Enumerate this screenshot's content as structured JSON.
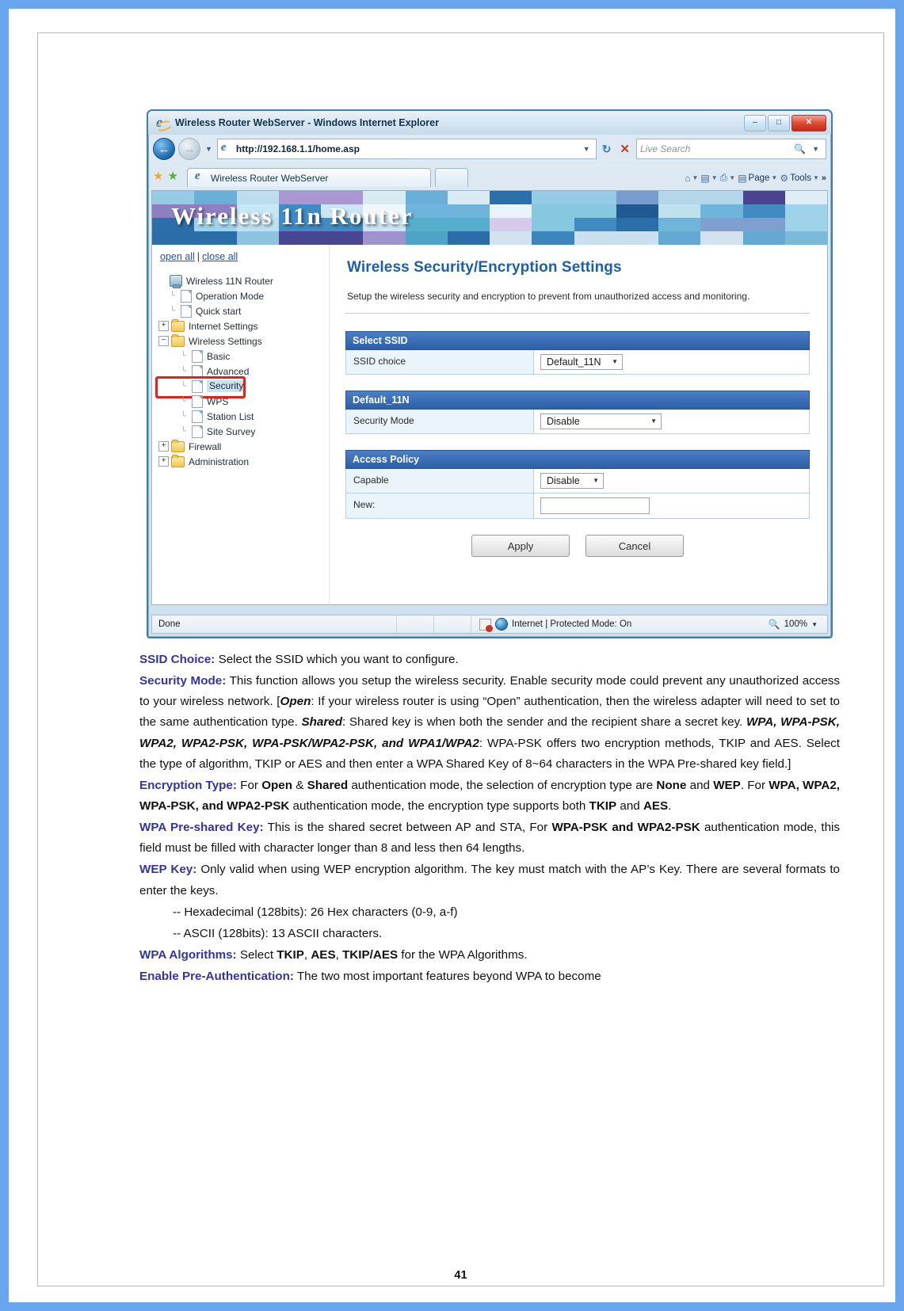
{
  "browser": {
    "window_title": "Wireless Router WebServer - Windows Internet Explorer",
    "minimize_label": "–",
    "maximize_label": "□",
    "close_label": "✕",
    "back_glyph": "←",
    "forward_glyph": "→",
    "nav_caret": "▼",
    "address_url": "http://192.168.1.1/home.asp",
    "address_caret": "▼",
    "refresh_glyph": "↻",
    "stop_glyph": "✕",
    "search_placeholder": "Live Search",
    "search_glyph": "🔍",
    "search_caret": "▼",
    "favorites_star": "★",
    "favorites_add": "★",
    "tab_title": "Wireless Router WebServer",
    "command_bar": [
      {
        "icon": "⌂",
        "label": "",
        "caret": "▼"
      },
      {
        "icon": "▤",
        "label": "",
        "caret": "▼"
      },
      {
        "icon": "⎙",
        "label": "",
        "caret": "▼"
      },
      {
        "icon": "▤",
        "label": "Page",
        "caret": "▼"
      },
      {
        "icon": "⚙",
        "label": "Tools",
        "caret": "▼"
      }
    ],
    "overflow_glyph": "»",
    "status": {
      "left": "Done",
      "zone": "Internet | Protected Mode: On",
      "zoom": "100%",
      "zoom_caret": "▼",
      "zoom_glyph": "🔍"
    }
  },
  "router_ui": {
    "banner_title": "Wireless 11n Router",
    "open_all": "open all",
    "separator": "|",
    "close_all": "close all",
    "tree": [
      {
        "label": "Wireless 11N Router",
        "icon": "computer-icon",
        "depth": 0,
        "expander": "",
        "selected": false,
        "highlight": false
      },
      {
        "label": "Operation Mode",
        "icon": "page-icon",
        "depth": 1,
        "expander": "",
        "selected": false,
        "highlight": false
      },
      {
        "label": "Quick start",
        "icon": "page-icon",
        "depth": 1,
        "expander": "",
        "selected": false,
        "highlight": false
      },
      {
        "label": "Internet Settings",
        "icon": "folder-icon",
        "depth": 0,
        "expander": "+",
        "selected": false,
        "highlight": false
      },
      {
        "label": "Wireless Settings",
        "icon": "folder-icon",
        "depth": 0,
        "expander": "−",
        "selected": false,
        "highlight": false
      },
      {
        "label": "Basic",
        "icon": "page-icon",
        "depth": 2,
        "expander": "",
        "selected": false,
        "highlight": false
      },
      {
        "label": "Advanced",
        "icon": "page-icon",
        "depth": 2,
        "expander": "",
        "selected": false,
        "highlight": false
      },
      {
        "label": "Security",
        "icon": "page-icon",
        "depth": 2,
        "expander": "",
        "selected": true,
        "highlight": true
      },
      {
        "label": "WPS",
        "icon": "page-icon",
        "depth": 2,
        "expander": "",
        "selected": false,
        "highlight": false
      },
      {
        "label": "Station List",
        "icon": "page-icon",
        "depth": 2,
        "expander": "",
        "selected": false,
        "highlight": false
      },
      {
        "label": "Site Survey",
        "icon": "page-icon",
        "depth": 2,
        "expander": "",
        "selected": false,
        "highlight": false
      },
      {
        "label": "Firewall",
        "icon": "folder-icon",
        "depth": 0,
        "expander": "+",
        "selected": false,
        "highlight": false
      },
      {
        "label": "Administration",
        "icon": "folder-icon",
        "depth": 0,
        "expander": "+",
        "selected": false,
        "highlight": false
      }
    ],
    "heading": "Wireless Security/Encryption Settings",
    "description": "Setup the wireless security and encryption to prevent from unauthorized access and monitoring.",
    "sections": [
      {
        "title": "Select SSID",
        "rows": [
          {
            "label": "SSID choice",
            "control": "select",
            "value": "Default_11N",
            "caret": "▼",
            "width_class": "w-ssid"
          }
        ]
      },
      {
        "title": "Default_11N",
        "rows": [
          {
            "label": "Security Mode",
            "control": "select",
            "value": "Disable",
            "caret": "▼",
            "width_class": "w-sec"
          }
        ]
      },
      {
        "title": "Access Policy",
        "rows": [
          {
            "label": "Capable",
            "control": "select",
            "value": "Disable",
            "caret": "▼",
            "width_class": "w-cap"
          },
          {
            "label": "New:",
            "control": "text",
            "value": "",
            "caret": "",
            "width_class": ""
          }
        ]
      }
    ],
    "apply_label": "Apply",
    "cancel_label": "Cancel"
  },
  "document": {
    "paragraphs": [
      {
        "heading": "SSID Choice:",
        "runs": [
          {
            "t": " Select the SSID which you want to configure."
          }
        ]
      },
      {
        "heading": "Security Mode:",
        "runs": [
          {
            "t": " This function allows you setup the wireless security. Enable security mode could prevent any unauthorized access to your wireless network. ["
          },
          {
            "t": "Open",
            "style": "bold-italic"
          },
          {
            "t": ": If your wireless router is using “Open” authentication, then the wireless adapter will need to set to the same authentication type. "
          },
          {
            "t": "Shared",
            "style": "bold-italic"
          },
          {
            "t": ": Shared key is when both the sender and the recipient share a secret key. "
          },
          {
            "t": "WPA, WPA-PSK, WPA2, WPA2-PSK, WPA-PSK/WPA2-PSK, and WPA1/WPA2",
            "style": "bold-italic"
          },
          {
            "t": ": WPA-PSK offers two encryption methods, TKIP and AES. Select the type of algorithm, TKIP or AES and then enter a WPA Shared Key of 8~64 characters in the WPA Pre-shared key field.]"
          }
        ]
      },
      {
        "heading": "Encryption Type:",
        "runs": [
          {
            "t": " For "
          },
          {
            "t": "Open",
            "style": "bold"
          },
          {
            "t": " & "
          },
          {
            "t": "Shared",
            "style": "bold"
          },
          {
            "t": " authentication mode, the selection of encryption type are "
          },
          {
            "t": "None",
            "style": "bold"
          },
          {
            "t": " and "
          },
          {
            "t": "WEP",
            "style": "bold"
          },
          {
            "t": ". For "
          },
          {
            "t": "WPA, WPA2, WPA-PSK, and WPA2-PSK",
            "style": "bold"
          },
          {
            "t": " authentication mode, the encryption type supports both "
          },
          {
            "t": "TKIP",
            "style": "bold"
          },
          {
            "t": " and "
          },
          {
            "t": "AES",
            "style": "bold"
          },
          {
            "t": "."
          }
        ]
      },
      {
        "heading": "WPA Pre-shared Key:",
        "runs": [
          {
            "t": " This is the shared secret between AP and STA, For "
          },
          {
            "t": "WPA-PSK and WPA2-PSK",
            "style": "bold"
          },
          {
            "t": " authentication mode, this field must be filled with character longer than 8 and less then 64 lengths."
          }
        ]
      },
      {
        "heading": "WEP Key:",
        "runs": [
          {
            "t": " Only valid when using WEP encryption algorithm. The key must match with the AP’s Key. There are several formats to enter the keys."
          }
        ]
      }
    ],
    "bullets": [
      "-- Hexadecimal (128bits): 26 Hex characters (0-9, a-f)",
      "-- ASCII (128bits): 13 ASCII characters."
    ],
    "paragraphs_tail": [
      {
        "heading": "WPA Algorithms:",
        "runs": [
          {
            "t": " Select "
          },
          {
            "t": "TKIP",
            "style": "bold"
          },
          {
            "t": ", "
          },
          {
            "t": "AES",
            "style": "bold"
          },
          {
            "t": ", "
          },
          {
            "t": "TKIP/AES",
            "style": "bold"
          },
          {
            "t": " for the WPA Algorithms."
          }
        ]
      },
      {
        "heading": "Enable Pre-Authentication:",
        "runs": [
          {
            "t": " The two most important features beyond WPA to become"
          }
        ]
      }
    ],
    "page_number": "41"
  },
  "colors": {
    "heading_blue": "#3333a8",
    "router_heading": "#1b5fb0",
    "section_header": "#2d5fa8",
    "highlight_red": "#e8201a",
    "page_border": "#6aa6f0"
  }
}
